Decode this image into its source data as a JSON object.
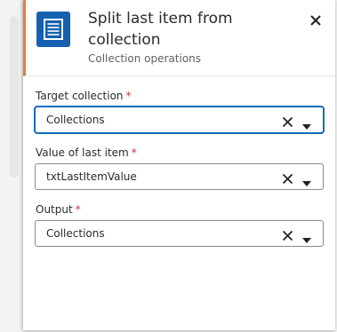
{
  "header": {
    "title": "Split last item from collection",
    "subtitle": "Collection operations",
    "icon": "list-icon",
    "accent_color": "#ea7d2e",
    "icon_bg_color": "#1560b0"
  },
  "fields": [
    {
      "label": "Target collection",
      "required_mark": "*",
      "value": "Collections",
      "focused": true
    },
    {
      "label": "Value of last item",
      "required_mark": "*",
      "value": "txtLastItemValue",
      "focused": false
    },
    {
      "label": "Output",
      "required_mark": "*",
      "value": "Collections",
      "focused": false
    }
  ],
  "colors": {
    "focus_border": "#0f6cbd",
    "required": "#d13438"
  }
}
